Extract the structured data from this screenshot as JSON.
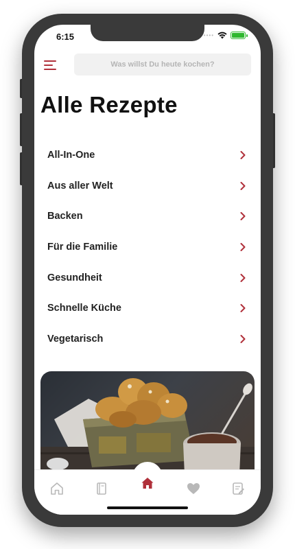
{
  "status_bar": {
    "time": "6:15",
    "signal": "••••"
  },
  "header": {
    "search_placeholder": "Was willst Du heute kochen?",
    "menu_icon": "hamburger-menu-icon"
  },
  "main": {
    "title": "Alle Rezepte",
    "categories": [
      {
        "label": "All-In-One"
      },
      {
        "label": "Aus aller Welt"
      },
      {
        "label": "Backen"
      },
      {
        "label": "Für die Familie"
      },
      {
        "label": "Gesundheit"
      },
      {
        "label": "Schnelle Küche"
      },
      {
        "label": "Vegetarisch"
      }
    ]
  },
  "hero_image": {
    "subject": "bread-basket-and-hot-chocolate"
  },
  "tab_bar": {
    "tabs": [
      {
        "icon": "home-outline-icon",
        "active": false
      },
      {
        "icon": "cookbook-icon",
        "active": false
      },
      {
        "icon": "home-icon",
        "active": true
      },
      {
        "icon": "heart-icon",
        "active": false
      },
      {
        "icon": "notes-icon",
        "active": false
      }
    ]
  },
  "colors": {
    "accent": "#b0303a",
    "text": "#222222",
    "tab_inactive": "#b8b8b8",
    "battery": "#2eb82e",
    "search_bg": "#f1f1f1"
  }
}
